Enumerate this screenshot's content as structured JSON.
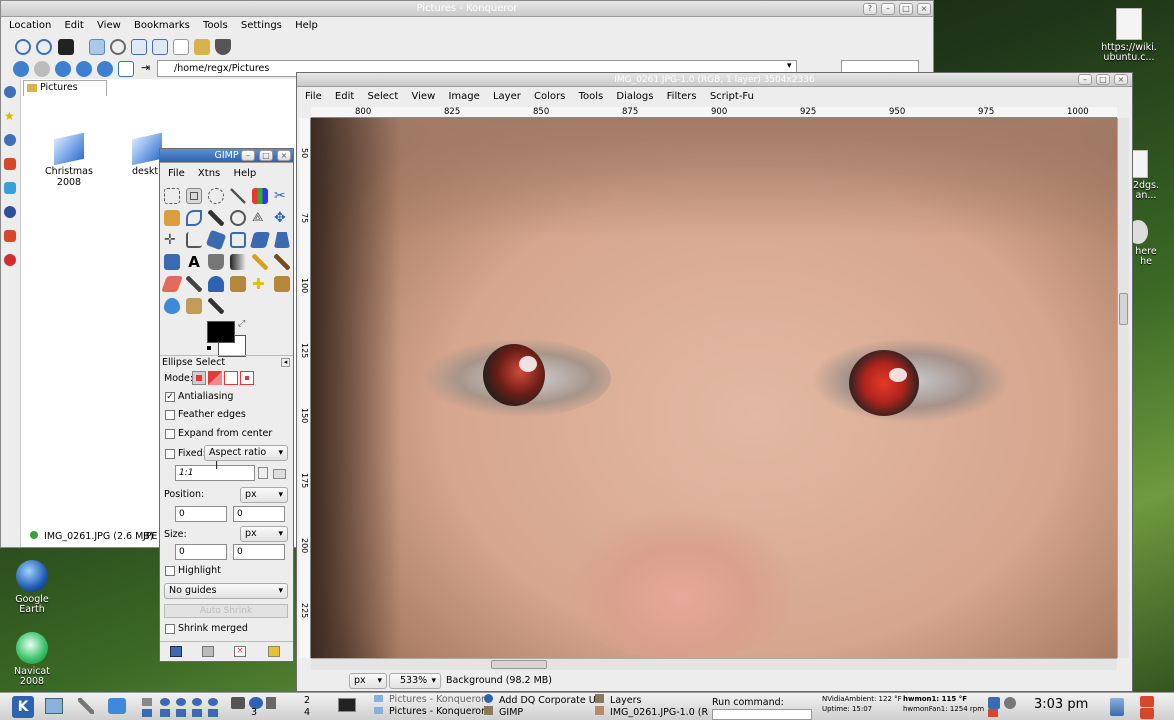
{
  "desktop": {
    "icons": [
      {
        "label": "https://wiki.\nubuntu.c..."
      },
      {
        "label": "Google\nEarth"
      },
      {
        "label": "Navicat\n2008"
      }
    ],
    "partial_labels": [
      "2dgs.\nan...",
      "here\nhe"
    ]
  },
  "konqueror": {
    "title": "Pictures - Konqueror",
    "menu": [
      "Location",
      "Edit",
      "View",
      "Bookmarks",
      "Tools",
      "Settings",
      "Help"
    ],
    "address": "/home/regx/Pictures",
    "tab": "Pictures",
    "files": [
      "Christmas 2008",
      "deskt"
    ],
    "status": "IMG_0261.JPG (2.6 MB)",
    "status_extra": "JPE"
  },
  "toolbox": {
    "title": "GIMP",
    "menu": [
      "File",
      "Xtns",
      "Help"
    ],
    "tool_name": "Ellipse Select",
    "mode_label": "Mode:",
    "antialiasing": "Antialiasing",
    "feather": "Feather edges",
    "expand": "Expand from center",
    "fixed": "Fixed:",
    "fixed_value": "Aspect ratio",
    "ratio": "1:1",
    "position": "Position:",
    "size": "Size:",
    "unit": "px",
    "pos_x": "0",
    "pos_y": "0",
    "size_x": "0",
    "size_y": "0",
    "highlight": "Highlight",
    "guides": "No guides",
    "auto_shrink": "Auto Shrink",
    "shrink_merged": "Shrink merged"
  },
  "image_window": {
    "title": "IMG_0261.JPG-1.0 (RGB, 1 layer) 3504x2336",
    "menu": [
      "File",
      "Edit",
      "Select",
      "View",
      "Image",
      "Layer",
      "Colors",
      "Tools",
      "Dialogs",
      "Filters",
      "Script-Fu"
    ],
    "ruler_ticks": [
      "800",
      "825",
      "850",
      "875",
      "900",
      "925",
      "950",
      "975",
      "1000"
    ],
    "vruler_ticks": [
      "50",
      "75",
      "100",
      "125",
      "150",
      "175",
      "200",
      "225"
    ],
    "unit": "px",
    "zoom": "533%",
    "status": "Background (98.2 MB)"
  },
  "taskbar": {
    "desktops": [
      "2",
      "3",
      "4"
    ],
    "tasks": [
      "Pictures - Konqueror",
      "Pictures - Konqueror",
      "Add DQ Corporate U",
      "GIMP",
      "Layers",
      "IMG_0261.JPG-1.0 (R"
    ],
    "run_label": "Run command:",
    "sensors": [
      "NVidiaAmbient: 122 °F",
      "Uptime: 15:07",
      "hwmon1: 115 °F",
      "hwmonFan1: 1254 rpm"
    ],
    "clock": "3:03 pm"
  },
  "colors": {
    "fg": "#000000",
    "bg": "#ffffff"
  }
}
